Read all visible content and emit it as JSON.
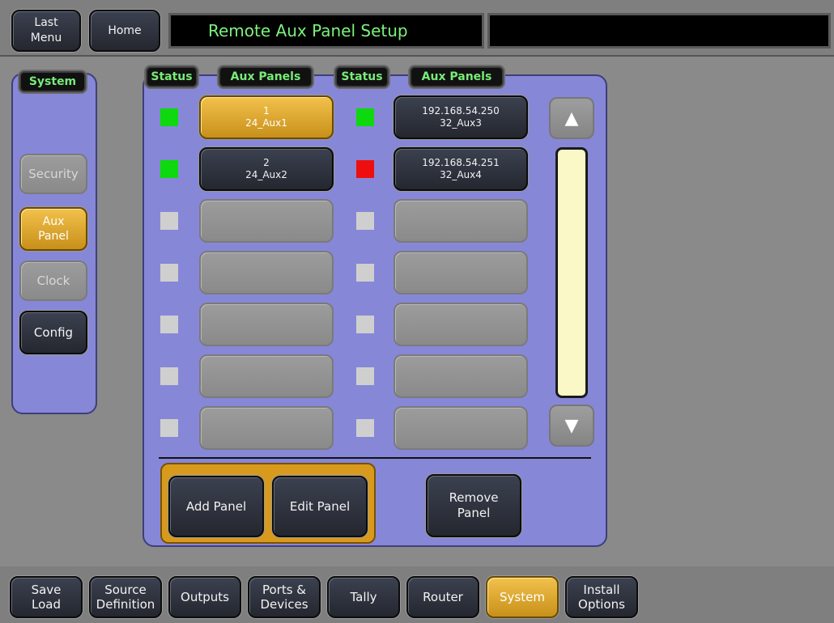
{
  "header": {
    "last_menu_label": "Last\nMenu",
    "home_label": "Home",
    "title": "Remote Aux Panel Setup",
    "message": ""
  },
  "side": {
    "tab_label": "System",
    "items": [
      {
        "label": "Security",
        "state": "disabled"
      },
      {
        "label": "Aux\nPanel",
        "state": "selected"
      },
      {
        "label": "Clock",
        "state": "disabled"
      },
      {
        "label": "Config",
        "state": "normal"
      }
    ]
  },
  "main": {
    "col_headers": [
      "Status",
      "Aux Panels",
      "Status",
      "Aux Panels"
    ],
    "left_column": [
      {
        "status": "green",
        "line1": "1",
        "line2": "24_Aux1",
        "selected": true
      },
      {
        "status": "green",
        "line1": "2",
        "line2": "24_Aux2",
        "selected": false
      },
      {
        "status": "empty",
        "line1": "",
        "line2": "",
        "selected": false
      },
      {
        "status": "empty",
        "line1": "",
        "line2": "",
        "selected": false
      },
      {
        "status": "empty",
        "line1": "",
        "line2": "",
        "selected": false
      },
      {
        "status": "empty",
        "line1": "",
        "line2": "",
        "selected": false
      },
      {
        "status": "empty",
        "line1": "",
        "line2": "",
        "selected": false
      }
    ],
    "right_column": [
      {
        "status": "green",
        "line1": "192.168.54.250",
        "line2": "32_Aux3",
        "selected": false
      },
      {
        "status": "red",
        "line1": "192.168.54.251",
        "line2": "32_Aux4",
        "selected": false
      },
      {
        "status": "empty",
        "line1": "",
        "line2": "",
        "selected": false
      },
      {
        "status": "empty",
        "line1": "",
        "line2": "",
        "selected": false
      },
      {
        "status": "empty",
        "line1": "",
        "line2": "",
        "selected": false
      },
      {
        "status": "empty",
        "line1": "",
        "line2": "",
        "selected": false
      },
      {
        "status": "empty",
        "line1": "",
        "line2": "",
        "selected": false
      }
    ],
    "scroll_up_icon": "triangle-up-icon",
    "scroll_down_icon": "triangle-down-icon",
    "actions": {
      "add_panel": "Add Panel",
      "edit_panel": "Edit Panel",
      "remove_panel": "Remove\nPanel"
    }
  },
  "footer": {
    "items": [
      {
        "label": "Save\nLoad",
        "selected": false
      },
      {
        "label": "Source\nDefinition",
        "selected": false
      },
      {
        "label": "Outputs",
        "selected": false
      },
      {
        "label": "Ports &\nDevices",
        "selected": false
      },
      {
        "label": "Tally",
        "selected": false
      },
      {
        "label": "Router",
        "selected": false
      },
      {
        "label": "System",
        "selected": true
      },
      {
        "label": "Install\nOptions",
        "selected": false
      }
    ]
  },
  "colors": {
    "panel": "#8787d8",
    "status_green": "#0ed80e",
    "status_red": "#ee0e0e",
    "selected_gold": "#d89a1c",
    "title_text": "#7cf27c"
  }
}
